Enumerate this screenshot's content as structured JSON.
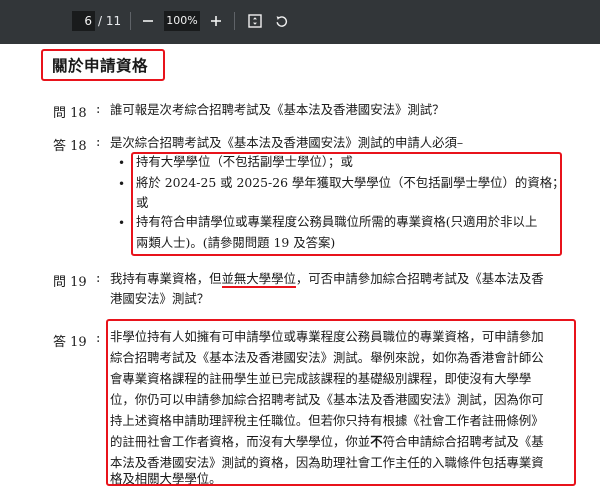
{
  "toolbar": {
    "current_page": "6",
    "total_pages": "/ 11",
    "zoom": "100%",
    "icons": [
      "zoom-out-icon",
      "zoom-in-icon",
      "fit-page-icon",
      "rotate-icon"
    ]
  },
  "section_title": "關於申請資格",
  "q18": {
    "label": "問 18",
    "colon": ":",
    "text": "誰可報是次考綜合招聘考試及《基本法及香港國安法》測試？"
  },
  "a18": {
    "label": "答 18",
    "colon": ":",
    "intro": "是次綜合招聘考試及《基本法及香港國安法》測試的申請人必須–",
    "items": [
      "持有大學學位（不包括副學士學位）；或",
      "將於 2024-25 或 2025-26 學年獲取大學學位（不包括副學士學位）的資格；",
      "或",
      "持有符合申請學位或專業程度公務員職位所需的專業資格(只適用於非以上",
      "兩類人士)。(請參閱問題 19 及答案)"
    ]
  },
  "q19": {
    "label": "問 19",
    "colon": ":",
    "line1_pre": "我持有專業資格，但",
    "line1_underlined": "並無大學學位",
    "line1_post": "，可否申請參加綜合招聘考試及《基本法及香",
    "line2": "港國安法》測試？"
  },
  "a19": {
    "label": "答 19",
    "colon": ":",
    "lines": [
      "非學位持有人如擁有可申請學位或專業程度公務員職位的專業資格，可申請參加",
      "綜合招聘考試及《基本法及香港國安法》測試。舉例來說，如你為香港會計師公",
      "會專業資格課程的註冊學生並已完成該課程的基礎級別課程，即使沒有大學學",
      "位，你仍可以申請參加綜合招聘考試及《基本法及香港國安法》測試，因為你可",
      "持上述資格申請助理評稅主任職位。但若你只持有根據《社會工作者註冊條例》",
      "的註冊社會工作者資格，而沒有大學學位，你並",
      "符合申請綜合招聘考試及《基",
      "本法及香港國安法》測試的資格，因為助理社會工作主任的入職條件包括專業資",
      "格及相關大學學位。"
    ],
    "bold_word": "不"
  }
}
